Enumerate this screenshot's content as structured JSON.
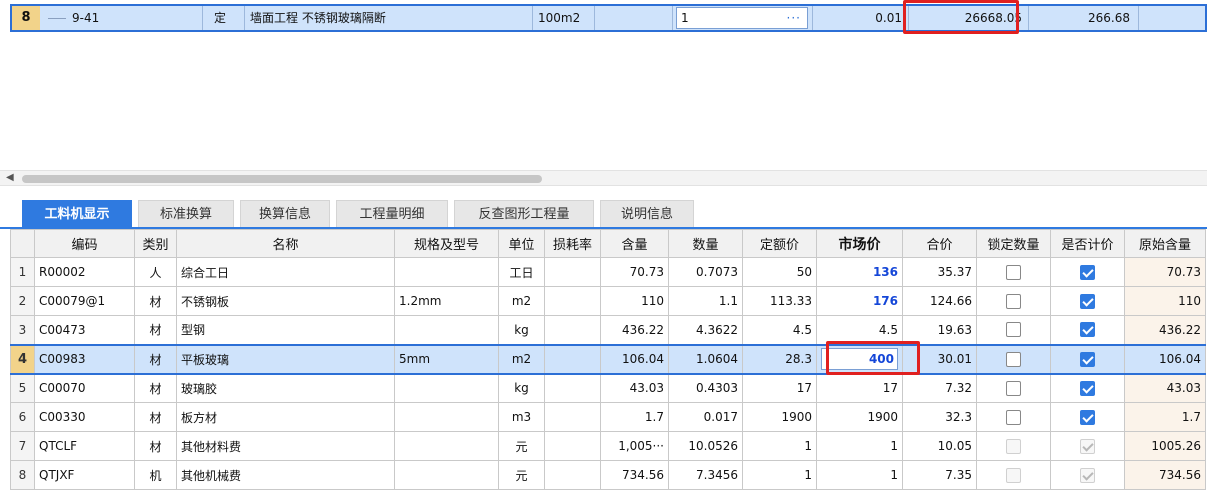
{
  "top_row": {
    "row_num": "8",
    "code": "9-41",
    "category": "定",
    "name": "墙面工程 不锈钢玻璃隔断",
    "unit": "100m2",
    "quantity": "1",
    "dots": "···",
    "rate": "0.01",
    "unit_price": "26668.05",
    "total": "266.68"
  },
  "tabs": [
    {
      "label": "工料机显示",
      "active": true
    },
    {
      "label": "标准换算",
      "active": false
    },
    {
      "label": "换算信息",
      "active": false
    },
    {
      "label": "工程量明细",
      "active": false
    },
    {
      "label": "反查图形工程量",
      "active": false
    },
    {
      "label": "说明信息",
      "active": false
    }
  ],
  "columns": [
    "",
    "编码",
    "类别",
    "名称",
    "规格及型号",
    "单位",
    "损耗率",
    "含量",
    "数量",
    "定额价",
    "市场价",
    "合价",
    "锁定数量",
    "是否计价",
    "原始含量"
  ],
  "rows": [
    {
      "n": "1",
      "code": "R00002",
      "type": "人",
      "name": "综合工日",
      "spec": "",
      "unit": "工日",
      "loss": "",
      "content": "70.73",
      "qty": "0.7073",
      "quota": "50",
      "market": "136",
      "sum": "35.37",
      "lock": false,
      "priced": true,
      "orig": "70.73",
      "market_blue": true,
      "disabled": false,
      "selected": false
    },
    {
      "n": "2",
      "code": "C00079@1",
      "type": "材",
      "name": "不锈钢板",
      "spec": "1.2mm",
      "unit": "m2",
      "loss": "",
      "content": "110",
      "qty": "1.1",
      "quota": "113.33",
      "market": "176",
      "sum": "124.66",
      "lock": false,
      "priced": true,
      "orig": "110",
      "market_blue": true,
      "disabled": false,
      "selected": false
    },
    {
      "n": "3",
      "code": "C00473",
      "type": "材",
      "name": "型钢",
      "spec": "",
      "unit": "kg",
      "loss": "",
      "content": "436.22",
      "qty": "4.3622",
      "quota": "4.5",
      "market": "4.5",
      "sum": "19.63",
      "lock": false,
      "priced": true,
      "orig": "436.22",
      "market_blue": false,
      "disabled": false,
      "selected": false
    },
    {
      "n": "4",
      "code": "C00983",
      "type": "材",
      "name": "平板玻璃",
      "spec": "5mm",
      "unit": "m2",
      "loss": "",
      "content": "106.04",
      "qty": "1.0604",
      "quota": "28.3",
      "market": "400",
      "sum": "30.01",
      "lock": false,
      "priced": true,
      "orig": "106.04",
      "market_blue": true,
      "disabled": false,
      "selected": true
    },
    {
      "n": "5",
      "code": "C00070",
      "type": "材",
      "name": "玻璃胶",
      "spec": "",
      "unit": "kg",
      "loss": "",
      "content": "43.03",
      "qty": "0.4303",
      "quota": "17",
      "market": "17",
      "sum": "7.32",
      "lock": false,
      "priced": true,
      "orig": "43.03",
      "market_blue": false,
      "disabled": false,
      "selected": false
    },
    {
      "n": "6",
      "code": "C00330",
      "type": "材",
      "name": "板方材",
      "spec": "",
      "unit": "m3",
      "loss": "",
      "content": "1.7",
      "qty": "0.017",
      "quota": "1900",
      "market": "1900",
      "sum": "32.3",
      "lock": false,
      "priced": true,
      "orig": "1.7",
      "market_blue": false,
      "disabled": false,
      "selected": false
    },
    {
      "n": "7",
      "code": "QTCLF",
      "type": "材",
      "name": "其他材料费",
      "spec": "",
      "unit": "元",
      "loss": "",
      "content": "1,005···",
      "qty": "10.0526",
      "quota": "1",
      "market": "1",
      "sum": "10.05",
      "lock": false,
      "priced": true,
      "orig": "1005.26",
      "market_blue": false,
      "disabled": true,
      "selected": false
    },
    {
      "n": "8",
      "code": "QTJXF",
      "type": "机",
      "name": "其他机械费",
      "spec": "",
      "unit": "元",
      "loss": "",
      "content": "734.56",
      "qty": "7.3456",
      "quota": "1",
      "market": "1",
      "sum": "7.35",
      "lock": false,
      "priced": true,
      "orig": "734.56",
      "market_blue": false,
      "disabled": true,
      "selected": false
    }
  ]
}
